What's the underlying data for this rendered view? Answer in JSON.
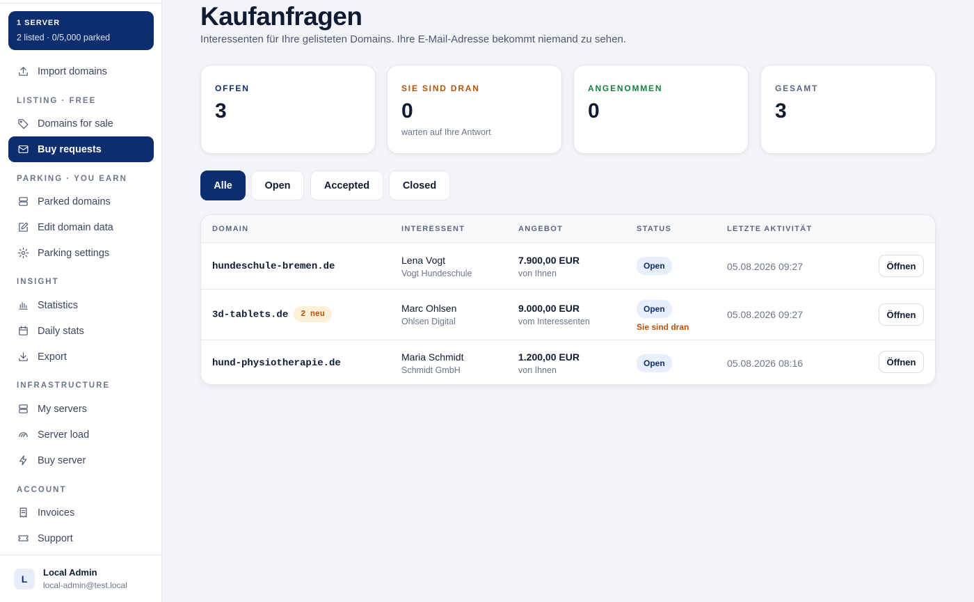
{
  "sidebar": {
    "server_card": {
      "title": "1 SERVER",
      "subtitle": "2 listed · 0/5,000 parked"
    },
    "import": {
      "label": "Import domains",
      "icon": "upload-icon"
    },
    "sections": [
      {
        "label": "LISTING · FREE"
      },
      {
        "label": "PARKING · YOU EARN"
      },
      {
        "label": "INSIGHT"
      },
      {
        "label": "INFRASTRUCTURE"
      },
      {
        "label": "ACCOUNT"
      }
    ],
    "items": [
      {
        "label": "Domains for sale",
        "icon": "tag-icon"
      },
      {
        "label": "Buy requests",
        "icon": "mail-icon",
        "active": true
      },
      {
        "label": "Parked domains",
        "icon": "server-icon"
      },
      {
        "label": "Edit domain data",
        "icon": "edit-icon"
      },
      {
        "label": "Parking settings",
        "icon": "gear-icon"
      },
      {
        "label": "Statistics",
        "icon": "bar-chart-icon"
      },
      {
        "label": "Daily stats",
        "icon": "calendar-icon"
      },
      {
        "label": "Export",
        "icon": "download-icon"
      },
      {
        "label": "My servers",
        "icon": "server-icon"
      },
      {
        "label": "Server load",
        "icon": "gauge-icon"
      },
      {
        "label": "Buy server",
        "icon": "bolt-icon"
      },
      {
        "label": "Invoices",
        "icon": "receipt-icon"
      },
      {
        "label": "Support",
        "icon": "ticket-icon"
      }
    ],
    "user": {
      "initial": "L",
      "name": "Local Admin",
      "email": "local-admin@test.local"
    }
  },
  "main": {
    "title": "Kaufanfragen",
    "subtitle": "Interessenten für Ihre gelisteten Domains. Ihre E-Mail-Adresse bekommt niemand zu sehen.",
    "stats": [
      {
        "label": "OFFEN",
        "value": "3",
        "hint": "",
        "color": "#0c2d6e"
      },
      {
        "label": "SIE SIND DRAN",
        "value": "0",
        "hint": "warten auf Ihre Antwort",
        "color": "#b45309"
      },
      {
        "label": "ANGENOMMEN",
        "value": "0",
        "hint": "",
        "color": "#15803d"
      },
      {
        "label": "GESAMT",
        "value": "3",
        "hint": "",
        "color": "#5b6680"
      }
    ],
    "filters": [
      "Alle",
      "Open",
      "Accepted",
      "Closed"
    ],
    "active_filter": "Alle",
    "table": {
      "headers": [
        "DOMAIN",
        "INTERESSENT",
        "ANGEBOT",
        "STATUS",
        "LETZTE AKTIVITÄT"
      ],
      "rows": [
        {
          "domain": "hundeschule-bremen.de",
          "badge": "",
          "name": "Lena Vogt",
          "company": "Vogt Hundeschule",
          "price": "7.900,00 EUR",
          "price_from": "von Ihnen",
          "status": "Open",
          "note": "",
          "activity": "05.08.2026 09:27",
          "action": "Öffnen"
        },
        {
          "domain": "3d-tablets.de",
          "badge": "2 neu",
          "name": "Marc Ohlsen",
          "company": "Ohlsen Digital",
          "price": "9.000,00 EUR",
          "price_from": "vom Interessenten",
          "status": "Open",
          "note": "Sie sind dran",
          "activity": "05.08.2026 09:27",
          "action": "Öffnen"
        },
        {
          "domain": "hund-physiotherapie.de",
          "badge": "",
          "name": "Maria Schmidt",
          "company": "Schmidt GmbH",
          "price": "1.200,00 EUR",
          "price_from": "von Ihnen",
          "status": "Open",
          "note": "",
          "activity": "05.08.2026 08:16",
          "action": "Öffnen"
        }
      ]
    }
  }
}
